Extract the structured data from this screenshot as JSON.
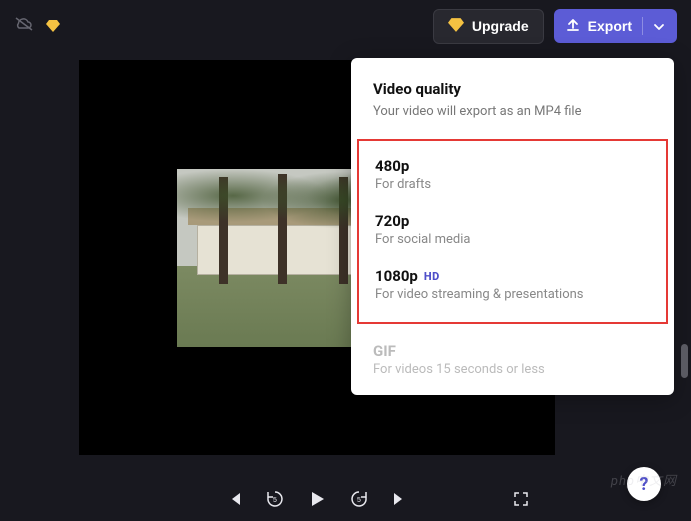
{
  "topbar": {
    "upgrade_label": "Upgrade",
    "export_label": "Export"
  },
  "quality_panel": {
    "title": "Video quality",
    "subtitle": "Your video will export as an MP4 file",
    "options": [
      {
        "label": "480p",
        "desc": "For drafts",
        "hd": false
      },
      {
        "label": "720p",
        "desc": "For social media",
        "hd": false
      },
      {
        "label": "1080p",
        "desc": "For video streaming & presentations",
        "hd": true
      }
    ],
    "gif": {
      "label": "GIF",
      "desc": "For videos 15 seconds or less"
    },
    "hd_badge": "HD"
  },
  "help": "?",
  "watermark": "php中文网"
}
